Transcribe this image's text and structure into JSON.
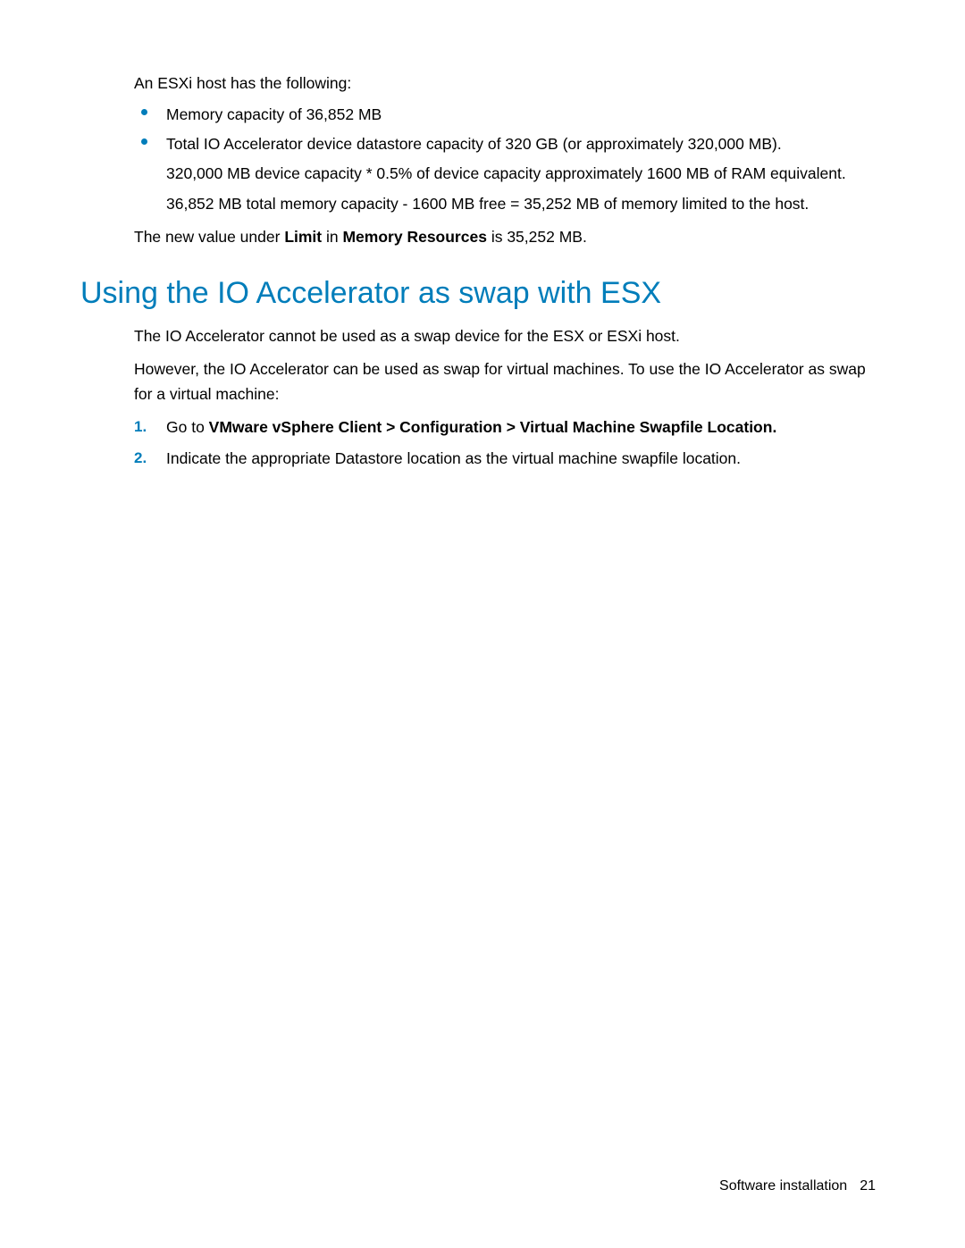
{
  "intro": "An ESXi host has the following:",
  "bullets": [
    {
      "lead": "Memory capacity of 36,852 MB",
      "subs": []
    },
    {
      "lead": "Total IO Accelerator device datastore capacity of 320 GB (or approximately 320,000 MB).",
      "subs": [
        "320,000 MB device capacity * 0.5% of device capacity approximately 1600 MB of RAM equivalent.",
        "36,852 MB total memory capacity - 1600 MB free = 35,252 MB of memory limited to the host."
      ]
    }
  ],
  "after_list_prefix": "The new value under ",
  "after_list_bold1": "Limit",
  "after_list_mid": " in ",
  "after_list_bold2": "Memory Resources",
  "after_list_suffix": " is 35,252 MB.",
  "heading": "Using the IO Accelerator as swap with ESX",
  "p1": "The IO Accelerator cannot be used as a swap device for the ESX or ESXi host.",
  "p2": "However, the IO Accelerator can be used as swap for virtual machines. To use the IO Accelerator as swap for a virtual machine:",
  "steps": [
    {
      "num": "1.",
      "prefix": "Go to ",
      "bold": "VMware vSphere Client > Configuration > Virtual Machine Swapfile Location.",
      "suffix": ""
    },
    {
      "num": "2.",
      "prefix": "Indicate the appropriate Datastore location as the virtual machine swapfile location.",
      "bold": "",
      "suffix": ""
    }
  ],
  "footer_section": "Software installation",
  "footer_page": "21"
}
